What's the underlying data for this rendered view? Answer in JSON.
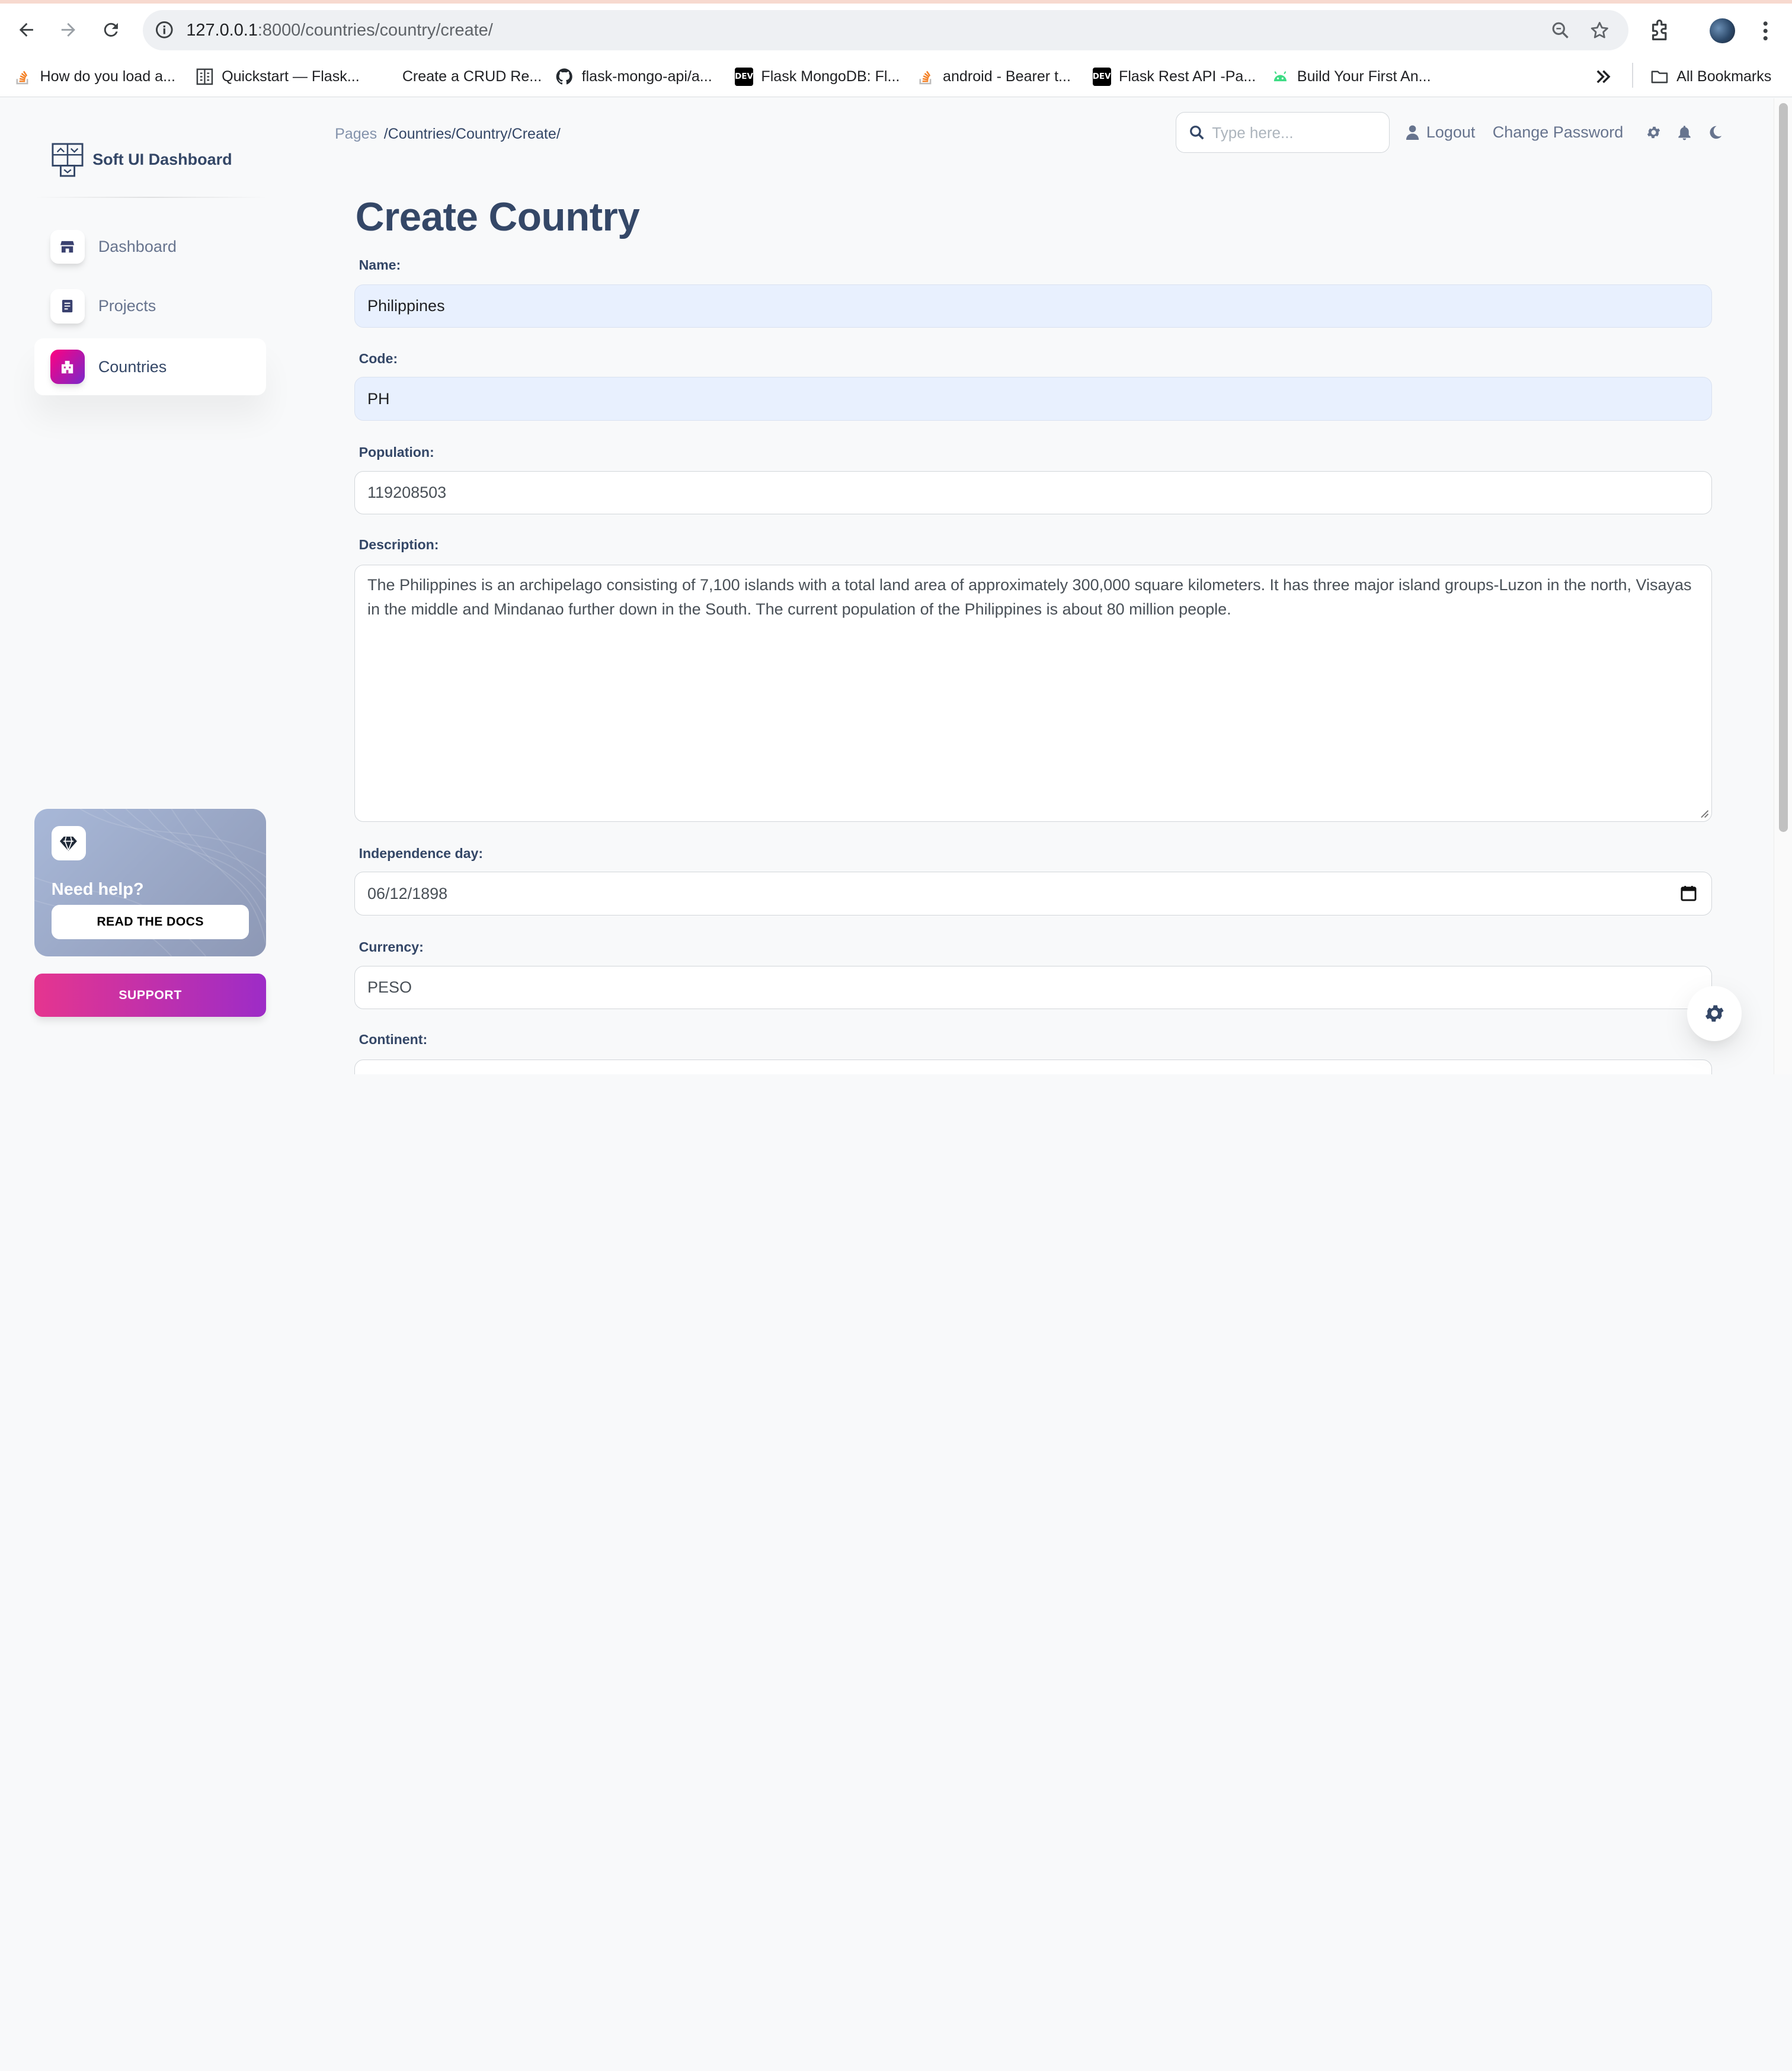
{
  "browser": {
    "url_host": "127.0.0.1",
    "url_path": ":8000/countries/country/create/",
    "bookmarks": [
      {
        "label": "How do you load a...",
        "icon": "stackoverflow-icon"
      },
      {
        "label": "Quickstart — Flask...",
        "icon": "docs-icon"
      },
      {
        "label": "Create a CRUD Re...",
        "icon": "blank-icon"
      },
      {
        "label": "flask-mongo-api/a...",
        "icon": "github-icon"
      },
      {
        "label": "Flask MongoDB: Fl...",
        "icon": "dev-icon"
      },
      {
        "label": "android - Bearer t...",
        "icon": "stackoverflow-icon"
      },
      {
        "label": "Flask Rest API -Pa...",
        "icon": "dev-icon"
      },
      {
        "label": "Build Your First An...",
        "icon": "android-icon"
      }
    ],
    "all_bookmarks": "All Bookmarks",
    "dev_badge": "DEV"
  },
  "sidebar": {
    "brand": "Soft UI Dashboard",
    "items": [
      {
        "label": "Dashboard",
        "icon": "shop-icon",
        "active": false
      },
      {
        "label": "Projects",
        "icon": "document-icon",
        "active": false
      },
      {
        "label": "Countries",
        "icon": "office-icon",
        "active": true
      }
    ],
    "help": {
      "title": "Need help?",
      "button": "READ THE DOCS"
    },
    "support": "SUPPORT"
  },
  "header": {
    "breadcrumb_root": "Pages",
    "breadcrumb_path": "/Countries/Country/Create/",
    "search_placeholder": "Type here...",
    "logout": "Logout",
    "change_password": "Change Password"
  },
  "form": {
    "title": "Create Country",
    "fields": {
      "name": {
        "label": "Name:",
        "value": "Philippines"
      },
      "code": {
        "label": "Code:",
        "value": "PH"
      },
      "population": {
        "label": "Population:",
        "value": "119208503"
      },
      "description": {
        "label": "Description:",
        "value": "The Philippines is an archipelago consisting of 7,100 islands with a total land area of approximately 300,000 square kilometers. It has three major island groups-Luzon in the north, Visayas in the middle and Mindanao further down in the South. The current population of the Philippines is about 80 million people."
      },
      "independence_day": {
        "label": "Independence day:",
        "value": "06/12/1898"
      },
      "currency": {
        "label": "Currency:",
        "value": "PESO"
      },
      "continent": {
        "label": "Continent:",
        "value": ""
      }
    }
  },
  "colors": {
    "primary_text": "#344767",
    "secondary_text": "#67748e",
    "accent_gradient_start": "#ff0080",
    "accent_gradient_end": "#7928ca",
    "autofill_bg": "#e8f0fe"
  }
}
